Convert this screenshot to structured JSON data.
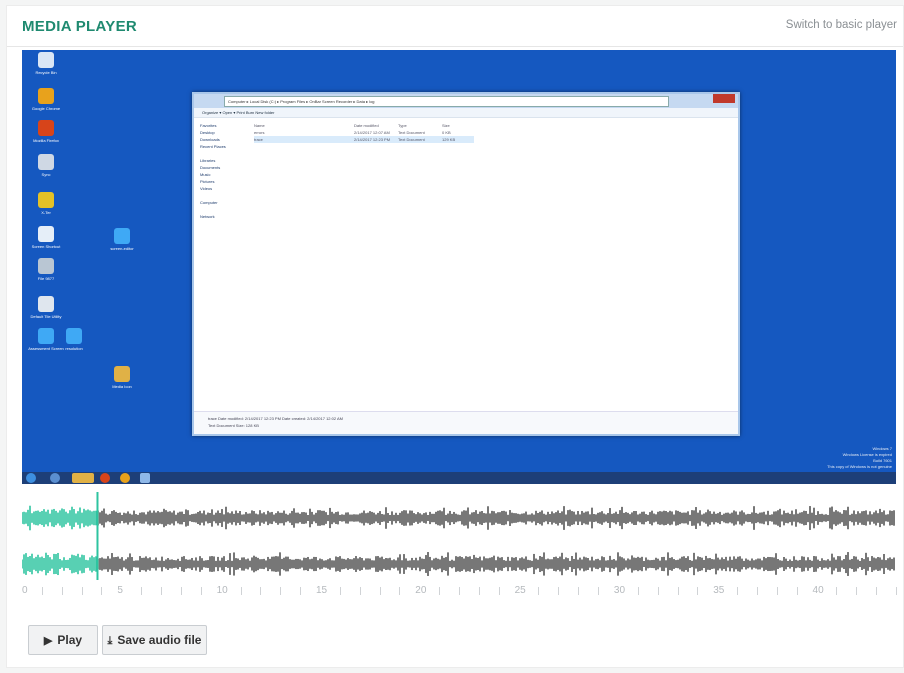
{
  "header": {
    "title": "MEDIA PLAYER",
    "switch_label": "Switch to basic player"
  },
  "video": {
    "desktop_icons": [
      {
        "label": "Recycle Bin",
        "icon": "recycle-bin-icon",
        "color": "#d9e6f5"
      },
      {
        "label": "Google Chrome",
        "icon": "chrome-icon",
        "color": "#e8a21c"
      },
      {
        "label": "Mozilla Firefox",
        "icon": "firefox-icon",
        "color": "#d7441a"
      },
      {
        "label": "Sync",
        "icon": "sync-icon",
        "color": "#cfd8e4"
      },
      {
        "label": "X-Ter",
        "icon": "x-app-icon",
        "color": "#e3c127"
      },
      {
        "label": "Screen Shortcut",
        "icon": "screen-shortcut-icon",
        "color": "#e5eef8"
      },
      {
        "label": "File 9877",
        "icon": "file-icon",
        "color": "#b9c6d3"
      },
      {
        "label": "Default Tile Utility",
        "icon": "tile-utility-icon",
        "color": "#dfe6ee"
      },
      {
        "label": "Assessment Screen",
        "icon": "assessment-icon",
        "color": "#3fa9f5"
      },
      {
        "label": "resolution",
        "icon": "resolution-icon",
        "color": "#3fa9f5"
      },
      {
        "label": "screen-editor",
        "icon": "screen-editor-icon",
        "color": "#3fa9f5"
      },
      {
        "label": "Media Icon",
        "icon": "media-icon",
        "color": "#e0b146"
      }
    ],
    "explorer": {
      "path": "Computer ▸ Local Disk (C:) ▸ Program Files ▸ OnBar Screen Recorder ▸ Data ▸ log",
      "toolbar": "Organize ▾   Open ▾   Print   Burn   New folder",
      "sidebar": [
        "Favorites",
        "Desktop",
        "Downloads",
        "Recent Places",
        "",
        "Libraries",
        "Documents",
        "Music",
        "Pictures",
        "Videos",
        "",
        "Computer",
        "",
        "Network"
      ],
      "columns": [
        "Name",
        "Date modified",
        "Type",
        "Size"
      ],
      "rows": [
        [
          "errors",
          "2/14/2017 12:07 AM",
          "Text Document",
          "0 KB"
        ],
        [
          "trace",
          "2/14/2017 12:23 PM",
          "Text Document",
          "129 KB"
        ]
      ],
      "status": [
        "trace    Date modified: 2/14/2017 12:23 PM    Date created: 2/14/2017 12:02 AM",
        "Text Document    Size: 128 KB"
      ]
    },
    "windows_note": [
      "Windows 7",
      "Windows License is expired",
      "Build 7601",
      "This copy of Windows is not genuine"
    ]
  },
  "timeline": {
    "labels": [
      "0",
      "5",
      "10",
      "15",
      "20",
      "25",
      "30",
      "35",
      "40"
    ],
    "max_seconds": 44,
    "played_seconds": 3.8
  },
  "buttons": {
    "play_label": "Play",
    "save_label": "Save audio file"
  },
  "colors": {
    "accent": "#1f8a70",
    "played_wave": "#2ec4a0",
    "unplayed_wave": "#555555",
    "video_bg": "#1558c0"
  }
}
